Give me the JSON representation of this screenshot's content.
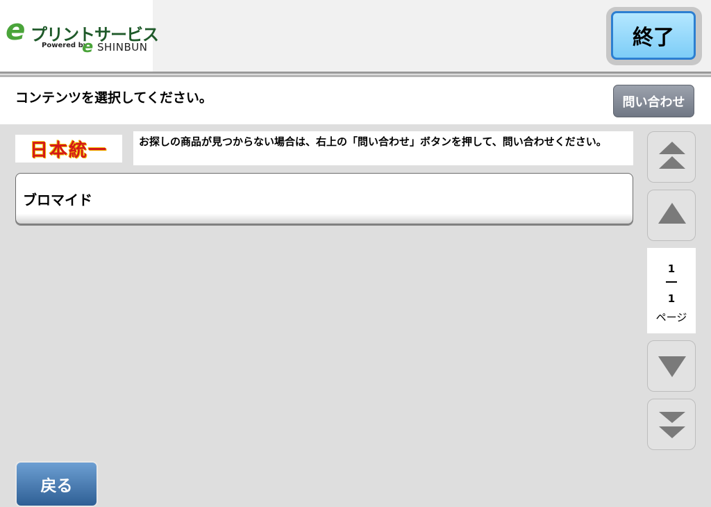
{
  "header": {
    "logo": {
      "e_letter": "e",
      "title": "プリントサービス",
      "powered_by": "Powered by",
      "e_letter_2": "e",
      "brand": "SHINBUN"
    },
    "end_label": "終了"
  },
  "title_bar": {
    "text": "コンテンツを選択してください。",
    "inquiry_label": "問い合わせ"
  },
  "banner": {
    "text": "日本統一"
  },
  "notice": "お探しの商品が見つからない場合は、右上の「問い合わせ」ボタンを押して、問い合わせください。",
  "items": [
    {
      "label": "ブロマイド"
    }
  ],
  "pager": {
    "current": "1",
    "total": "1",
    "label": "ページ",
    "buttons": [
      "first-page-icon",
      "prev-page-icon",
      "next-page-icon",
      "last-page-icon"
    ]
  },
  "footer": {
    "back_label": "戻る"
  },
  "colors": {
    "end_button": "#7dcdf7",
    "back_button": "#2e5f95",
    "inquiry_button": "#707784",
    "logo_green": "#4aa43a"
  }
}
